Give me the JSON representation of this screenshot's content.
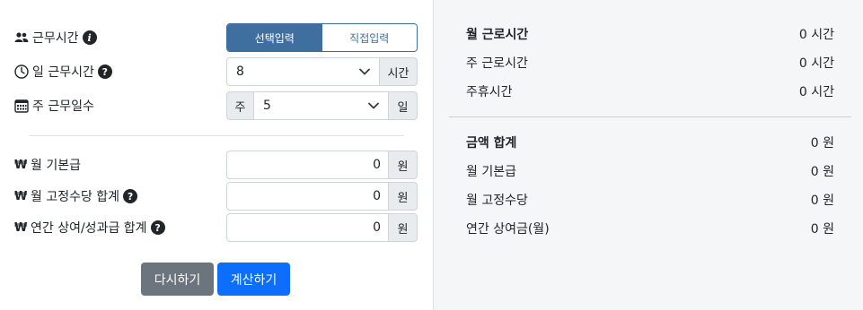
{
  "form": {
    "work_time": {
      "label": "근무시간",
      "tabs": [
        "선택입력",
        "직접입력"
      ],
      "active_tab": 0
    },
    "daily_hours": {
      "label": "일 근무시간",
      "value": "8",
      "unit": "시간"
    },
    "weekly_days": {
      "label": "주 근무일수",
      "prefix": "주",
      "value": "5",
      "unit": "일"
    },
    "monthly_base": {
      "label": "월 기본급",
      "value": "0",
      "unit": "원"
    },
    "monthly_fixed": {
      "label": "월 고정수당 합계",
      "value": "0",
      "unit": "원"
    },
    "annual_bonus": {
      "label": "연간 상여/성과급 합계",
      "value": "0",
      "unit": "원"
    },
    "won_symbol": "₩",
    "reset_label": "다시하기",
    "calc_label": "계산하기"
  },
  "summary": {
    "hours": [
      {
        "label": "월 근로시간",
        "value": "0 시간",
        "bold": true
      },
      {
        "label": "주 근로시간",
        "value": "0 시간"
      },
      {
        "label": "주휴시간",
        "value": "0 시간"
      }
    ],
    "amounts": [
      {
        "label": "금액 합계",
        "value": "0 원",
        "bold": true
      },
      {
        "label": "월 기본급",
        "value": "0 원"
      },
      {
        "label": "월 고정수당",
        "value": "0 원"
      },
      {
        "label": "연간 상여금(월)",
        "value": "0 원"
      }
    ]
  },
  "icons": [
    "users-icon",
    "info-icon",
    "clock-icon",
    "help-icon",
    "calendar-icon",
    "chevron-down-icon"
  ]
}
